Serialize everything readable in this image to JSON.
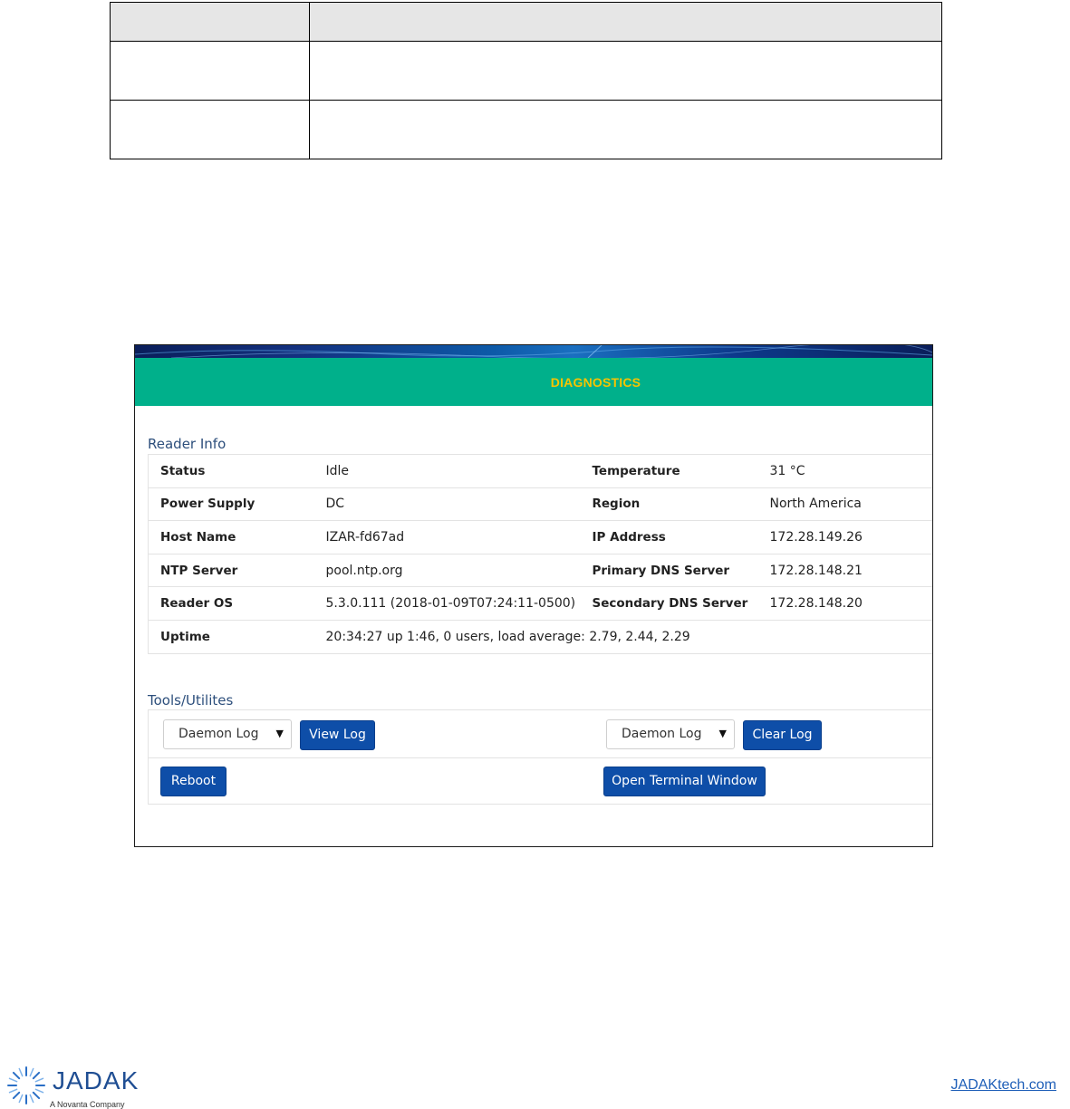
{
  "page": {
    "title": "DIAGNOSTICS"
  },
  "reader_info": {
    "section_title": "Reader Info",
    "rows": [
      {
        "label1": "Status",
        "value1": "Idle",
        "label2": "Temperature",
        "value2": "31 °C"
      },
      {
        "label1": "Power Supply",
        "value1": "DC",
        "label2": "Region",
        "value2": "North America"
      },
      {
        "label1": "Host Name",
        "value1": "IZAR-fd67ad",
        "label2": "IP Address",
        "value2": "172.28.149.26"
      },
      {
        "label1": "NTP Server",
        "value1": "pool.ntp.org",
        "label2": "Primary DNS Server",
        "value2": "172.28.148.21"
      },
      {
        "label1": "Reader OS",
        "value1": "5.3.0.111 (2018-01-09T07:24:11-0500)",
        "label2": "Secondary DNS Server",
        "value2": "172.28.148.20"
      },
      {
        "label1": "Uptime",
        "value1": "20:34:27 up 1:46, 0 users, load average: 2.79, 2.44, 2.29",
        "label2": "",
        "value2": ""
      }
    ]
  },
  "tools": {
    "section_title": "Tools/Utilites",
    "view_log_select": "Daemon Log",
    "view_log_button": "View Log",
    "clear_log_select": "Daemon Log",
    "clear_log_button": "Clear Log",
    "reboot_button": "Reboot",
    "terminal_button": "Open Terminal Window"
  },
  "footer": {
    "logo_text": "JADAK",
    "logo_subtext": "A Novanta Company",
    "link": "JADAKtech.com"
  },
  "colors": {
    "title_bar": "#00b08b",
    "title_text": "#f7c400",
    "button": "#0e4ea8",
    "section_title": "#2d4f7c"
  }
}
